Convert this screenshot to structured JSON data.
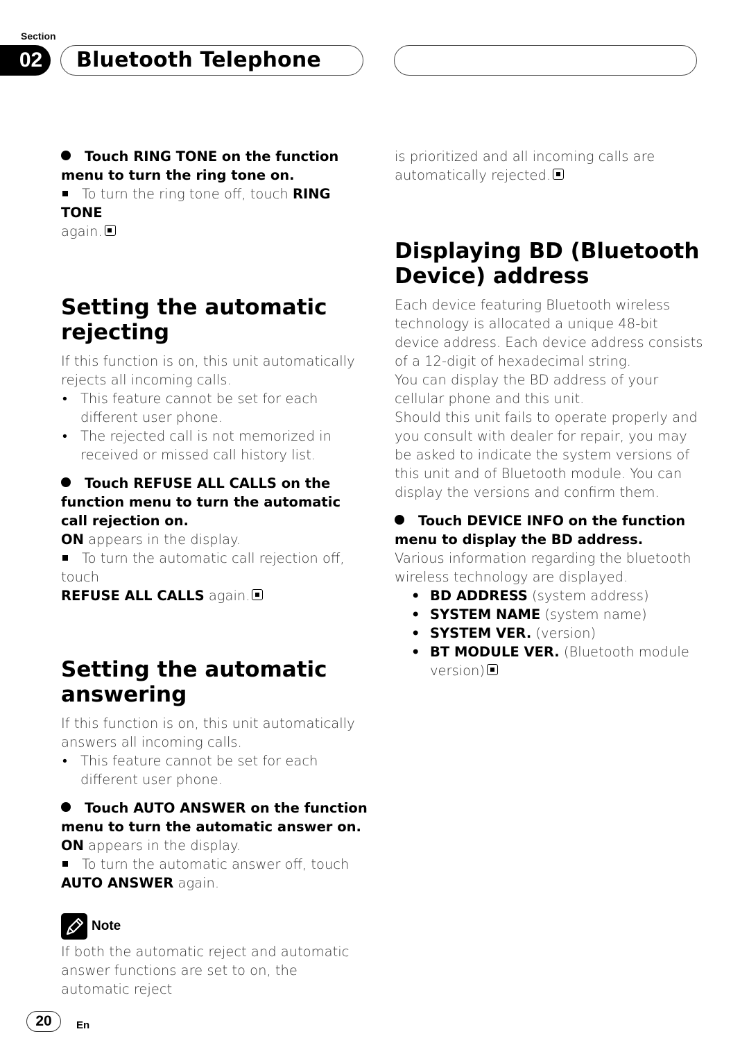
{
  "header": {
    "section_label": "Section",
    "section_number": "02",
    "title": "Bluetooth Telephone"
  },
  "left": {
    "ring_tone_step": {
      "prefix": "Touch ",
      "keyword": "RING TONE",
      "rest": " on the function menu to turn the ring tone on."
    },
    "ring_tone_note": {
      "text": "To turn the ring tone off, touch ",
      "keyword": "RING TONE",
      "tail": " again."
    },
    "rejecting": {
      "heading": "Setting the automatic rejecting",
      "intro": "If this function is on, this unit automatically rejects all incoming calls.",
      "bullets": [
        "This feature cannot be set for each different user phone.",
        "The rejected call is not memorized in received or missed call history list."
      ],
      "step": {
        "prefix": "Touch ",
        "keyword": "REFUSE ALL CALLS",
        "rest": " on the function menu to turn the automatic call rejection on."
      },
      "result_keyword": "ON",
      "result_text": " appears in the display.",
      "off_note": {
        "text": "To turn the automatic call rejection off, touch",
        "keyword": "REFUSE ALL CALLS",
        "tail": " again."
      }
    },
    "answering": {
      "heading": "Setting the automatic answering",
      "intro": "If this function is on, this unit automatically answers all incoming calls.",
      "bullets": [
        "This feature cannot be set for each different user phone."
      ],
      "step": {
        "prefix": "Touch ",
        "keyword": "AUTO ANSWER",
        "rest": " on the function menu to turn the automatic answer on."
      },
      "result_keyword": "ON",
      "result_text": " appears in the display.",
      "off_note": {
        "text": "To turn the automatic answer off, touch",
        "keyword": "AUTO ANSWER",
        "tail": " again."
      }
    },
    "note": {
      "label": "Note",
      "text": "If both the automatic reject and automatic answer functions are set to on, the automatic reject"
    }
  },
  "right": {
    "continued": "is prioritized and all incoming calls are automatically rejected.",
    "bd": {
      "heading": "Displaying BD (Bluetooth Device) address",
      "para1": "Each device featuring Bluetooth wireless technology is allocated a unique 48-bit device address. Each device address consists of a 12-digit of hexadecimal string.",
      "para2": "You can display the BD address of your cellular phone and this unit.",
      "para3": "Should this unit fails to operate properly and you consult with dealer for repair, you may be asked to indicate the system versions of this unit and of Bluetooth module. You can display the versions and confirm them.",
      "step": {
        "prefix": "Touch ",
        "keyword": "DEVICE INFO",
        "rest": " on the function menu to display the BD address."
      },
      "step_desc": "Various information regarding the bluetooth wireless technology are displayed.",
      "items": [
        {
          "keyword": "BD ADDRESS",
          "desc": " (system address)"
        },
        {
          "keyword": "SYSTEM NAME",
          "desc": " (system name)"
        },
        {
          "keyword": "SYSTEM VER.",
          "desc": " (version)"
        },
        {
          "keyword": "BT MODULE VER.",
          "desc": " (Bluetooth module version)"
        }
      ]
    }
  },
  "footer": {
    "page_number": "20",
    "language": "En"
  }
}
